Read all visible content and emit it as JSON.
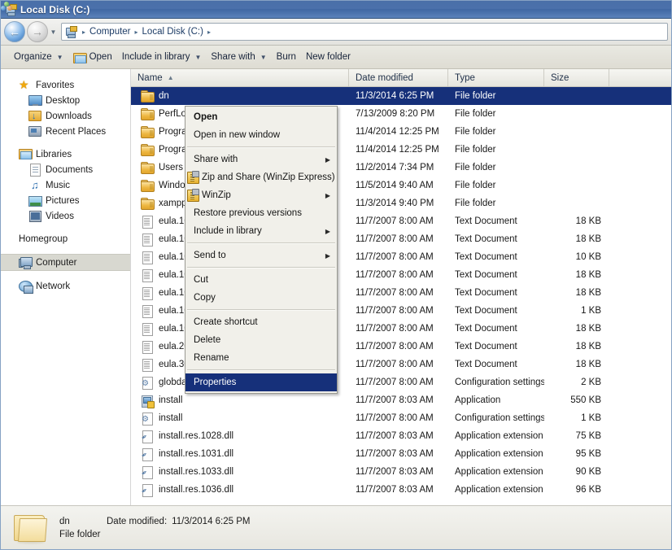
{
  "window": {
    "title": "Local Disk (C:)",
    "title_icon": "drive-computer-icon"
  },
  "nav": {
    "back_icon": "back-arrow-icon",
    "forward_icon": "forward-arrow-icon",
    "history_caret": "chevron-down-icon",
    "breadcrumbs": [
      {
        "label": "Computer"
      },
      {
        "label": "Local Disk (C:)"
      }
    ],
    "separator": "▸",
    "caret": "▾"
  },
  "toolbar": {
    "items": [
      {
        "label": "Organize",
        "has_caret": true,
        "icon": null
      },
      {
        "label": "Open",
        "has_caret": false,
        "icon": "open-folder-icon"
      },
      {
        "label": "Include in library",
        "has_caret": true,
        "icon": null
      },
      {
        "label": "Share with",
        "has_caret": true,
        "icon": null
      },
      {
        "label": "Burn",
        "has_caret": false,
        "icon": null
      },
      {
        "label": "New folder",
        "has_caret": false,
        "icon": null
      }
    ]
  },
  "sidebar": {
    "groups": [
      {
        "header": {
          "label": "Favorites",
          "icon": "star-icon"
        },
        "items": [
          {
            "label": "Desktop",
            "icon": "desktop-icon"
          },
          {
            "label": "Downloads",
            "icon": "downloads-icon"
          },
          {
            "label": "Recent Places",
            "icon": "recent-places-icon"
          }
        ]
      },
      {
        "header": {
          "label": "Libraries",
          "icon": "libraries-icon"
        },
        "items": [
          {
            "label": "Documents",
            "icon": "documents-icon"
          },
          {
            "label": "Music",
            "icon": "music-icon"
          },
          {
            "label": "Pictures",
            "icon": "pictures-icon"
          },
          {
            "label": "Videos",
            "icon": "videos-icon"
          }
        ]
      },
      {
        "header": {
          "label": "Homegroup",
          "icon": "homegroup-icon"
        },
        "items": []
      },
      {
        "header": {
          "label": "Computer",
          "icon": "computer-icon",
          "selected": true
        },
        "items": []
      },
      {
        "header": {
          "label": "Network",
          "icon": "network-icon"
        },
        "items": []
      }
    ]
  },
  "filelist": {
    "columns": [
      {
        "key": "name",
        "label": "Name",
        "sorted": true,
        "sort_mark": "▲"
      },
      {
        "key": "date",
        "label": "Date modified"
      },
      {
        "key": "type",
        "label": "Type"
      },
      {
        "key": "size",
        "label": "Size"
      }
    ],
    "rows": [
      {
        "name": "dn",
        "date": "11/3/2014 6:25 PM",
        "type": "File folder",
        "size": "",
        "icon": "folder-icon",
        "selected": true
      },
      {
        "name": "PerfLogs",
        "date": "7/13/2009 8:20 PM",
        "type": "File folder",
        "size": "",
        "icon": "folder-icon",
        "selected": false
      },
      {
        "name": "Program Files",
        "date": "11/4/2014 12:25 PM",
        "type": "File folder",
        "size": "",
        "icon": "folder-icon",
        "selected": false
      },
      {
        "name": "Program Files (x86)",
        "date": "11/4/2014 12:25 PM",
        "type": "File folder",
        "size": "",
        "icon": "folder-icon",
        "selected": false
      },
      {
        "name": "Users",
        "date": "11/2/2014 7:34 PM",
        "type": "File folder",
        "size": "",
        "icon": "folder-icon",
        "selected": false
      },
      {
        "name": "Windows",
        "date": "11/5/2014 9:40 AM",
        "type": "File folder",
        "size": "",
        "icon": "folder-icon",
        "selected": false
      },
      {
        "name": "xampp",
        "date": "11/3/2014 9:40 PM",
        "type": "File folder",
        "size": "",
        "icon": "folder-icon",
        "selected": false
      },
      {
        "name": "eula.1028",
        "date": "11/7/2007 8:00 AM",
        "type": "Text Document",
        "size": "18 KB",
        "icon": "text-document-icon",
        "selected": false
      },
      {
        "name": "eula.1031",
        "date": "11/7/2007 8:00 AM",
        "type": "Text Document",
        "size": "18 KB",
        "icon": "text-document-icon",
        "selected": false
      },
      {
        "name": "eula.1033",
        "date": "11/7/2007 8:00 AM",
        "type": "Text Document",
        "size": "10 KB",
        "icon": "text-document-icon",
        "selected": false
      },
      {
        "name": "eula.1036",
        "date": "11/7/2007 8:00 AM",
        "type": "Text Document",
        "size": "18 KB",
        "icon": "text-document-icon",
        "selected": false
      },
      {
        "name": "eula.1040",
        "date": "11/7/2007 8:00 AM",
        "type": "Text Document",
        "size": "18 KB",
        "icon": "text-document-icon",
        "selected": false
      },
      {
        "name": "eula.1041",
        "date": "11/7/2007 8:00 AM",
        "type": "Text Document",
        "size": "1 KB",
        "icon": "text-document-icon",
        "selected": false
      },
      {
        "name": "eula.1042",
        "date": "11/7/2007 8:00 AM",
        "type": "Text Document",
        "size": "18 KB",
        "icon": "text-document-icon",
        "selected": false
      },
      {
        "name": "eula.2052",
        "date": "11/7/2007 8:00 AM",
        "type": "Text Document",
        "size": "18 KB",
        "icon": "text-document-icon",
        "selected": false
      },
      {
        "name": "eula.3082",
        "date": "11/7/2007 8:00 AM",
        "type": "Text Document",
        "size": "18 KB",
        "icon": "text-document-icon",
        "selected": false
      },
      {
        "name": "globdata",
        "date": "11/7/2007 8:00 AM",
        "type": "Configuration settings",
        "size": "2 KB",
        "icon": "configuration-settings-icon",
        "selected": false
      },
      {
        "name": "install",
        "date": "11/7/2007 8:03 AM",
        "type": "Application",
        "size": "550 KB",
        "icon": "application-icon",
        "selected": false
      },
      {
        "name": "install",
        "date": "11/7/2007 8:00 AM",
        "type": "Configuration settings",
        "size": "1 KB",
        "icon": "configuration-settings-icon",
        "selected": false
      },
      {
        "name": "install.res.1028.dll",
        "date": "11/7/2007 8:03 AM",
        "type": "Application extension",
        "size": "75 KB",
        "icon": "application-extension-icon",
        "selected": false
      },
      {
        "name": "install.res.1031.dll",
        "date": "11/7/2007 8:03 AM",
        "type": "Application extension",
        "size": "95 KB",
        "icon": "application-extension-icon",
        "selected": false
      },
      {
        "name": "install.res.1033.dll",
        "date": "11/7/2007 8:03 AM",
        "type": "Application extension",
        "size": "90 KB",
        "icon": "application-extension-icon",
        "selected": false
      },
      {
        "name": "install.res.1036.dll",
        "date": "11/7/2007 8:03 AM",
        "type": "Application extension",
        "size": "96 KB",
        "icon": "application-extension-icon",
        "selected": false
      }
    ]
  },
  "context_menu": {
    "items": [
      {
        "label": "Open",
        "bold": true,
        "submenu": false,
        "icon": null,
        "highlighted": false,
        "separator_after": false
      },
      {
        "label": "Open in new window",
        "bold": false,
        "submenu": false,
        "icon": null,
        "highlighted": false,
        "separator_after": true
      },
      {
        "label": "Share with",
        "bold": false,
        "submenu": true,
        "icon": null,
        "highlighted": false,
        "separator_after": false
      },
      {
        "label": "Zip and Share (WinZip Express)",
        "bold": false,
        "submenu": false,
        "icon": "winzip-icon",
        "highlighted": false,
        "separator_after": false
      },
      {
        "label": "WinZip",
        "bold": false,
        "submenu": true,
        "icon": "winzip-icon",
        "highlighted": false,
        "separator_after": false
      },
      {
        "label": "Restore previous versions",
        "bold": false,
        "submenu": false,
        "icon": null,
        "highlighted": false,
        "separator_after": false
      },
      {
        "label": "Include in library",
        "bold": false,
        "submenu": true,
        "icon": null,
        "highlighted": false,
        "separator_after": true
      },
      {
        "label": "Send to",
        "bold": false,
        "submenu": true,
        "icon": null,
        "highlighted": false,
        "separator_after": true
      },
      {
        "label": "Cut",
        "bold": false,
        "submenu": false,
        "icon": null,
        "highlighted": false,
        "separator_after": false
      },
      {
        "label": "Copy",
        "bold": false,
        "submenu": false,
        "icon": null,
        "highlighted": false,
        "separator_after": true
      },
      {
        "label": "Create shortcut",
        "bold": false,
        "submenu": false,
        "icon": null,
        "highlighted": false,
        "separator_after": false
      },
      {
        "label": "Delete",
        "bold": false,
        "submenu": false,
        "icon": null,
        "highlighted": false,
        "separator_after": false
      },
      {
        "label": "Rename",
        "bold": false,
        "submenu": false,
        "icon": null,
        "highlighted": false,
        "separator_after": true
      },
      {
        "label": "Properties",
        "bold": false,
        "submenu": false,
        "icon": null,
        "highlighted": true,
        "separator_after": false
      }
    ],
    "submenu_arrow": "▶"
  },
  "details_pane": {
    "icon": "folder-large-icon",
    "name": "dn",
    "date_label": "Date modified:",
    "date_value": "11/3/2014 6:25 PM",
    "type": "File folder"
  },
  "colors": {
    "selection": "#16307a",
    "titlebar": "#4a6fa8",
    "chrome": "#e8e7e0"
  }
}
